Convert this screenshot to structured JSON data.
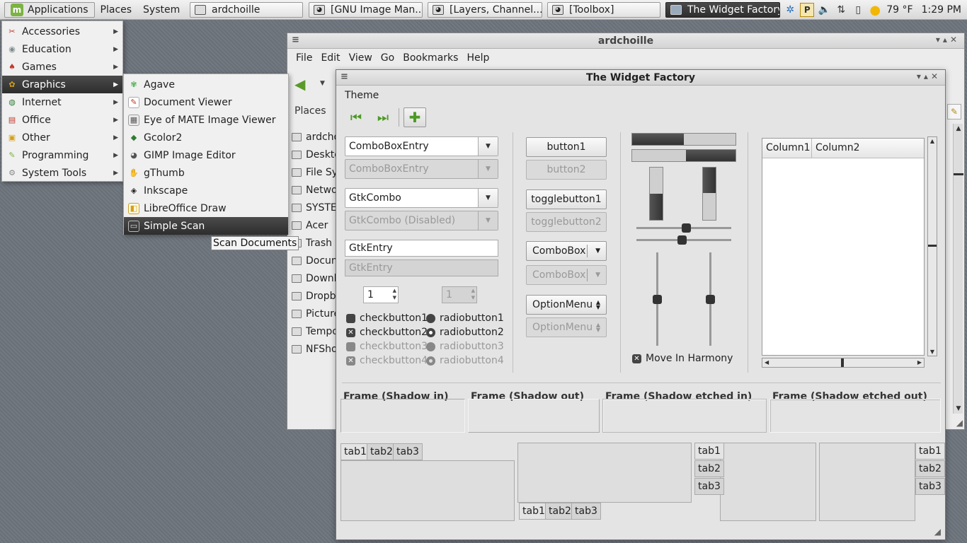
{
  "panel": {
    "menus": [
      "Applications",
      "Places",
      "System"
    ],
    "tasks": [
      {
        "label": "ardchoille",
        "icon": "folder-icon"
      },
      {
        "label": "[GNU Image Man...",
        "icon": "gimp-icon"
      },
      {
        "label": "[Layers, Channel...",
        "icon": "gimp-icon"
      },
      {
        "label": "[Toolbox]",
        "icon": "gimp-icon"
      },
      {
        "label": "The Widget Factory",
        "icon": "window-icon"
      }
    ],
    "weather": "79 °F",
    "clock": "1:29 PM"
  },
  "app_menu": {
    "categories": [
      {
        "label": "Accessories",
        "icon": "accessories-icon",
        "color": "#c0392b"
      },
      {
        "label": "Education",
        "icon": "education-icon",
        "color": "#7f8c8d"
      },
      {
        "label": "Games",
        "icon": "games-icon",
        "color": "#c0392b"
      },
      {
        "label": "Graphics",
        "icon": "graphics-icon",
        "color": "#d4a017"
      },
      {
        "label": "Internet",
        "icon": "internet-icon",
        "color": "#2e7d32"
      },
      {
        "label": "Office",
        "icon": "office-icon",
        "color": "#c0392b"
      },
      {
        "label": "Other",
        "icon": "other-icon",
        "color": "#d4a017"
      },
      {
        "label": "Programming",
        "icon": "programming-icon",
        "color": "#7cb342"
      },
      {
        "label": "System Tools",
        "icon": "system-tools-icon",
        "color": "#888888"
      }
    ],
    "selected_category": "Graphics",
    "graphics_items": [
      {
        "label": "Agave",
        "icon": "agave-icon"
      },
      {
        "label": "Document Viewer",
        "icon": "document-viewer-icon"
      },
      {
        "label": "Eye of MATE Image Viewer",
        "icon": "eye-of-mate-icon"
      },
      {
        "label": "Gcolor2",
        "icon": "gcolor2-icon"
      },
      {
        "label": "GIMP Image Editor",
        "icon": "gimp-icon"
      },
      {
        "label": "gThumb",
        "icon": "gthumb-icon"
      },
      {
        "label": "Inkscape",
        "icon": "inkscape-icon"
      },
      {
        "label": "LibreOffice Draw",
        "icon": "libreoffice-draw-icon"
      },
      {
        "label": "Simple Scan",
        "icon": "simple-scan-icon"
      }
    ],
    "selected_item": "Simple Scan",
    "tooltip": "Scan Documents"
  },
  "file_manager": {
    "title": "ardchoille",
    "menus": [
      "File",
      "Edit",
      "View",
      "Go",
      "Bookmarks",
      "Help"
    ],
    "sidebar_title": "Places",
    "places": [
      "ardcho",
      "Deskto",
      "File Sy",
      "Netwo",
      "SYSTEI",
      "Acer",
      "Trash",
      "Docum",
      "Downl",
      "Dropbo",
      "Picture",
      "Tempo",
      "NFSho"
    ]
  },
  "widget_factory": {
    "title": "The Widget Factory",
    "menu": "Theme",
    "combo_entry": "ComboBoxEntry",
    "combo_entry_disabled": "ComboBoxEntry",
    "gtk_combo": "GtkCombo",
    "gtk_combo_disabled": "GtkCombo (Disabled)",
    "entry": "GtkEntry",
    "entry_disabled": "GtkEntry",
    "spin_value": "1",
    "spin_disabled_value": "1",
    "checks": [
      {
        "label": "checkbutton1",
        "checked": false,
        "disabled": false
      },
      {
        "label": "checkbutton2",
        "checked": true,
        "disabled": false
      },
      {
        "label": "checkbutton3",
        "checked": false,
        "disabled": true
      },
      {
        "label": "checkbutton4",
        "checked": true,
        "disabled": true
      }
    ],
    "radios": [
      {
        "label": "radiobutton1",
        "checked": false,
        "disabled": false
      },
      {
        "label": "radiobutton2",
        "checked": true,
        "disabled": false
      },
      {
        "label": "radiobutton3",
        "checked": false,
        "disabled": true
      },
      {
        "label": "radiobutton4",
        "checked": true,
        "disabled": true
      }
    ],
    "button1": "button1",
    "button2": "button2",
    "toggle1": "togglebutton1",
    "toggle2": "togglebutton2",
    "combobox": "ComboBox",
    "combobox_disabled": "ComboBox",
    "option_menu": "OptionMenu",
    "option_menu_disabled": "OptionMenu",
    "hprogress1": 0.5,
    "hprogress2": 0.48,
    "vprogress1": 0.5,
    "vprogress2": 0.48,
    "hscale1": 0.52,
    "hscale2": 0.48,
    "vscale1": 0.5,
    "vscale2": 0.5,
    "move_in_harmony": "Move In Harmony",
    "columns": [
      "Column1",
      "Column2"
    ],
    "frames": [
      "Frame (Shadow in)",
      "Frame (Shadow out)",
      "Frame (Shadow etched in)",
      "Frame (Shadow etched out)"
    ],
    "tabs": [
      "tab1",
      "tab2",
      "tab3"
    ]
  }
}
